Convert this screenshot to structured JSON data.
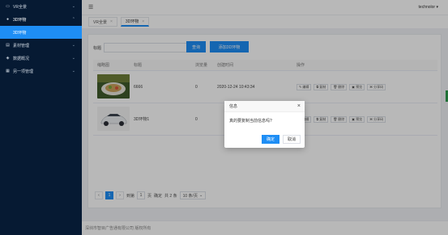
{
  "sidebar": {
    "items": [
      {
        "label": "VR全景",
        "icon": "vr-icon",
        "chevron": "⌄"
      },
      {
        "label": "3D环物",
        "icon": "cube-icon",
        "chevron": "⌃"
      },
      {
        "label": "3D环物"
      },
      {
        "label": "素材管理",
        "icon": "folder-icon",
        "chevron": "⌄"
      },
      {
        "label": "数据概况",
        "icon": "chart-icon",
        "chevron": "⌄"
      },
      {
        "label": "另一项管理",
        "icon": "list-icon",
        "chevron": "⌄"
      }
    ]
  },
  "header": {
    "user": "technolor ▾"
  },
  "tabs": [
    {
      "label": "VR全景",
      "close": "×"
    },
    {
      "label": "3D环物",
      "close": "×"
    }
  ],
  "search": {
    "label": "标题",
    "placeholder": "",
    "query_button": "查询",
    "add_button": "添加3D环物"
  },
  "table": {
    "headers": [
      "缩略图",
      "标题",
      "浏览量",
      "创建时间",
      "操作"
    ],
    "rows": [
      {
        "title": "6666",
        "views": "0",
        "created": "2020-12-24 10:43:34"
      },
      {
        "title": "3D环物1",
        "views": "0",
        "created": ""
      }
    ],
    "actions": [
      "编辑",
      "复制",
      "删除",
      "预览",
      "分享码"
    ]
  },
  "pagination": {
    "prev": "‹",
    "current": "1",
    "next": "›",
    "goto_label": "到第",
    "goto_value": "1",
    "page_unit": "页",
    "confirm": "确定",
    "total": "共 2 条",
    "page_size": "10 条/页"
  },
  "footer": {
    "text": "深圳市智目广告通有限公司 版权所有"
  },
  "dialog": {
    "title": "信息",
    "close": "×",
    "message": "真的要复制当前信息吗?",
    "confirm_button": "确定",
    "cancel_button": "取消"
  },
  "colors": {
    "sidebar_bg": "#061a33",
    "primary": "#1e8ef5",
    "accent_green": "#2c9c4b"
  }
}
